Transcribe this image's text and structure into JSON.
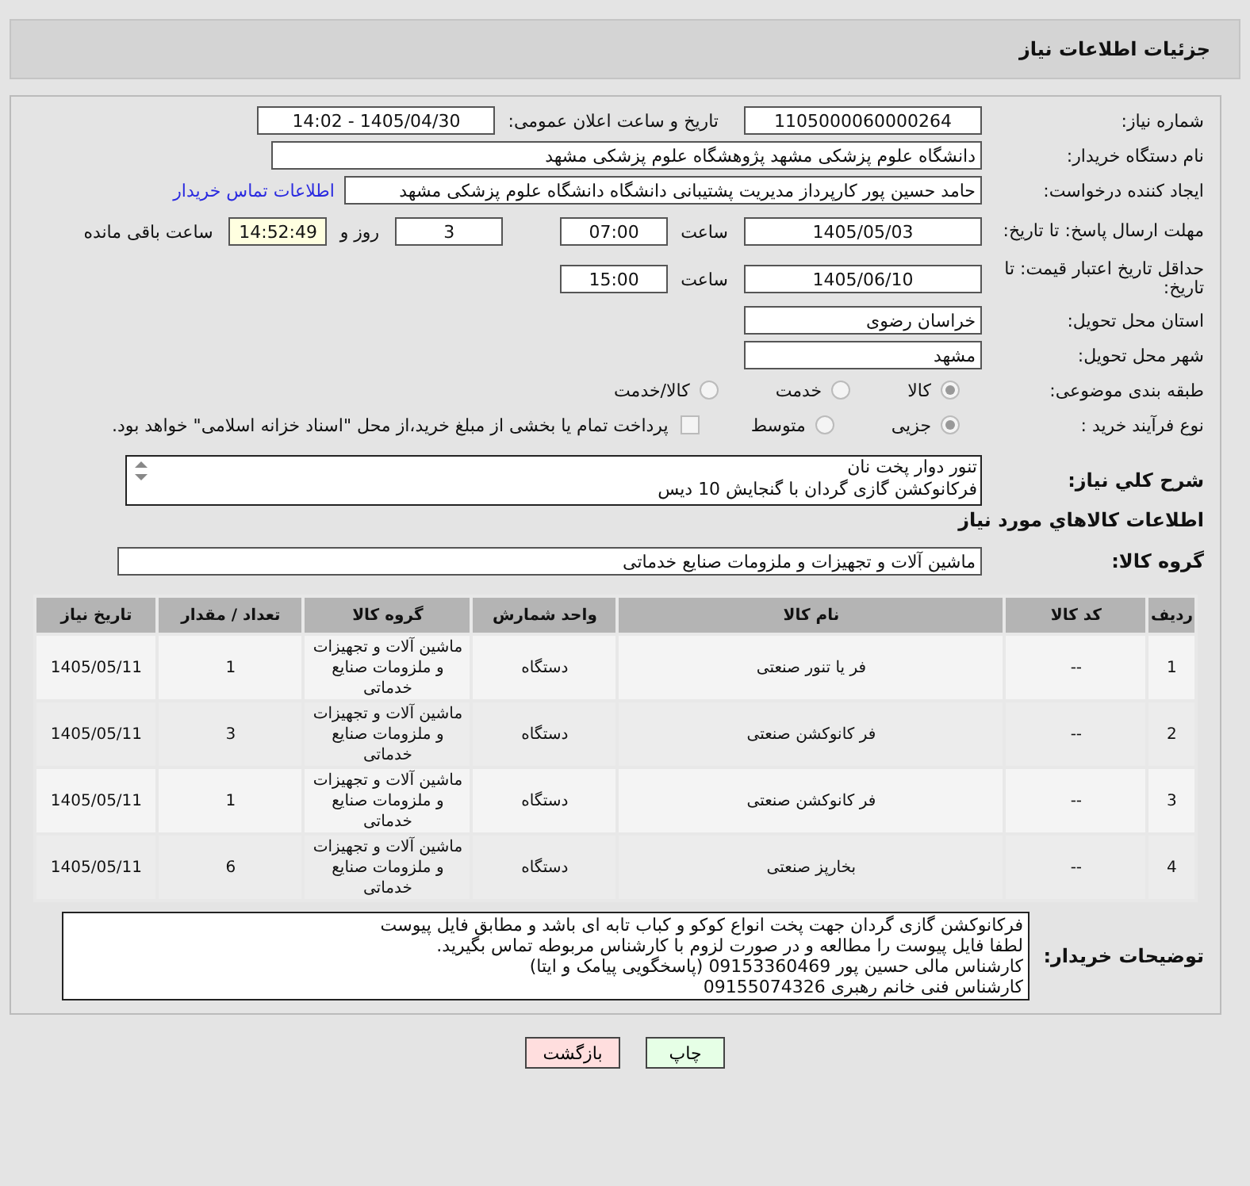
{
  "header": {
    "title": "جزئیات اطلاعات نیاز"
  },
  "need_number": {
    "label": "شماره نیاز:",
    "value": "1105000060000264"
  },
  "announce": {
    "label": "تاریخ و ساعت اعلان عمومی:",
    "value": "1405/04/30 - 14:02"
  },
  "buyer_org": {
    "label": "نام دستگاه خریدار:",
    "value": "دانشگاه علوم پزشکی مشهد   پژوهشگاه علوم پزشکی مشهد"
  },
  "requester": {
    "label": "ایجاد کننده درخواست:",
    "value": "حامد حسین پور کارپرداز مدیریت پشتیبانی دانشگاه دانشگاه علوم پزشکی مشهد",
    "link": "اطلاعات تماس خریدار"
  },
  "deadline": {
    "label": "مهلت ارسال پاسخ: تا تاریخ:",
    "date": "1405/05/03",
    "time_label": "ساعت",
    "time": "07:00",
    "days": "3",
    "days_label": "روز و",
    "remaining": "14:52:49",
    "remaining_label": "ساعت باقی مانده"
  },
  "validity": {
    "label": "حداقل تاریخ اعتبار قیمت: تا تاریخ:",
    "date": "1405/06/10",
    "time_label": "ساعت",
    "time": "15:00"
  },
  "province": {
    "label": "استان محل تحویل:",
    "value": "خراسان رضوی"
  },
  "city": {
    "label": "شهر محل تحویل:",
    "value": "مشهد"
  },
  "category": {
    "label": "طبقه بندی موضوعی:",
    "options": [
      {
        "label": "کالا",
        "selected": true
      },
      {
        "label": "خدمت",
        "selected": false
      },
      {
        "label": "کالا/خدمت",
        "selected": false
      }
    ]
  },
  "process": {
    "label": "نوع فرآیند خرید :",
    "options": [
      {
        "label": "جزیی",
        "selected": true
      },
      {
        "label": "متوسط",
        "selected": false
      }
    ],
    "payment": {
      "label": "پرداخت تمام یا بخشی از مبلغ خرید،از محل \"اسناد خزانه اسلامی\" خواهد بود.",
      "checked": false
    }
  },
  "description": {
    "label": "شرح کلي نياز:",
    "lines": [
      "تنور دوار پخت نان",
      "فرکانوکشن گازی گردان با گنجایش 10 دیس"
    ]
  },
  "goods_title": "اطلاعات کالاهاي مورد نياز",
  "goods_group": {
    "label": "گروه کالا:",
    "value": "ماشین آلات و تجهیزات و ملزومات صنایع خدماتی"
  },
  "table": {
    "columns": [
      "ردیف",
      "کد کالا",
      "نام کالا",
      "واحد شمارش",
      "گروه کالا",
      "تعداد / مقدار",
      "تاریخ نیاز"
    ],
    "rows": [
      [
        "1",
        "--",
        "فر یا تنور صنعتی",
        "دستگاه",
        "ماشین آلات و تجهیزات و ملزومات صنایع خدماتی",
        "1",
        "1405/05/11"
      ],
      [
        "2",
        "--",
        "فر کانوکشن صنعتی",
        "دستگاه",
        "ماشین آلات و تجهیزات و ملزومات صنایع خدماتی",
        "3",
        "1405/05/11"
      ],
      [
        "3",
        "--",
        "فر کانوکشن صنعتی",
        "دستگاه",
        "ماشین آلات و تجهیزات و ملزومات صنایع خدماتی",
        "1",
        "1405/05/11"
      ],
      [
        "4",
        "--",
        "بخارپز صنعتی",
        "دستگاه",
        "ماشین آلات و تجهیزات و ملزومات صنایع خدماتی",
        "6",
        "1405/05/11"
      ]
    ]
  },
  "buyer_notes": {
    "label": "توضیحات خریدار:",
    "lines": [
      "فرکانوکشن گازی گردان جهت پخت انواع کوکو و کباب تابه ای باشد و مطابق فایل پیوست",
      "لطفا فایل پیوست را مطالعه و در صورت لزوم با کارشناس مربوطه تماس بگیرید.",
      "کارشناس مالی حسین پور 09153360469 (پاسخگویی پیامک و ایتا)",
      "کارشناس فنی خانم رهبری 09155074326"
    ]
  },
  "buttons": [
    {
      "kind": "print",
      "label": "چاپ"
    },
    {
      "kind": "back",
      "label": "بازگشت"
    }
  ]
}
